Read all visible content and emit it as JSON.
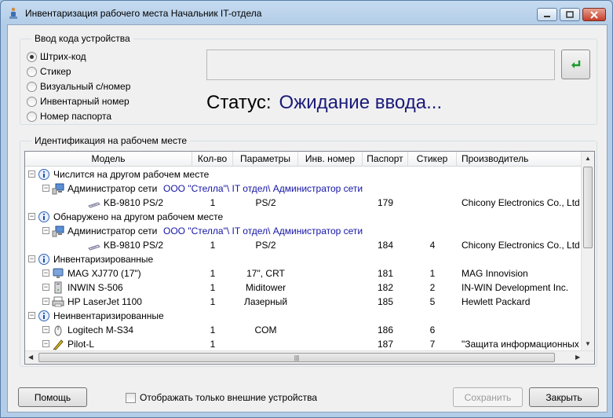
{
  "window": {
    "title": "Инвентаризация рабочего места Начальник IT-отдела"
  },
  "input_group": {
    "legend": "Ввод кода устройства",
    "options": [
      {
        "label": "Штрих-код",
        "selected": true
      },
      {
        "label": "Стикер",
        "selected": false
      },
      {
        "label": "Визуальный с/номер",
        "selected": false
      },
      {
        "label": "Инвентарный номер",
        "selected": false
      },
      {
        "label": "Номер паспорта",
        "selected": false
      }
    ],
    "code_value": "",
    "status_label": "Статус:",
    "status_value": "Ожидание ввода..."
  },
  "ident_group": {
    "legend": "Идентификация на рабочем месте",
    "columns": [
      "Модель",
      "Кол-во",
      "Параметры",
      "Инв. номер",
      "Паспорт",
      "Стикер",
      "Производитель"
    ],
    "rows": [
      {
        "level": 0,
        "icon": "info-icon",
        "model": "Числится на другом рабочем месте"
      },
      {
        "level": 1,
        "icon": "workstation-icon",
        "model": "Администратор сети",
        "path": "ООО \"Стелла\"\\ IT отдел\\ Администратор сети"
      },
      {
        "level": 2,
        "icon": "keyboard-icon",
        "model": "KB-9810 PS/2",
        "qty": "1",
        "params": "PS/2",
        "inv": "",
        "passport": "179",
        "sticker": "",
        "vendor": "Chicony Electronics Co., Ltd"
      },
      {
        "level": 0,
        "icon": "info-icon",
        "model": "Обнаружено на другом рабочем месте"
      },
      {
        "level": 1,
        "icon": "workstation-icon",
        "model": "Администратор сети",
        "path": "ООО \"Стелла\"\\ IT отдел\\ Администратор сети"
      },
      {
        "level": 2,
        "icon": "keyboard-icon",
        "model": "KB-9810 PS/2",
        "qty": "1",
        "params": "PS/2",
        "inv": "",
        "passport": "184",
        "sticker": "4",
        "vendor": "Chicony Electronics Co., Ltd"
      },
      {
        "level": 0,
        "icon": "info-icon",
        "model": "Инвентаризированные"
      },
      {
        "level": 1,
        "icon": "monitor-icon",
        "model": "MAG XJ770 (17\")",
        "qty": "1",
        "params": "17\", CRT",
        "inv": "",
        "passport": "181",
        "sticker": "1",
        "vendor": "MAG Innovision"
      },
      {
        "level": 1,
        "icon": "system-unit-icon",
        "model": "INWIN S-506",
        "qty": "1",
        "params": "Miditower",
        "inv": "",
        "passport": "182",
        "sticker": "2",
        "vendor": "IN-WIN Development Inc."
      },
      {
        "level": 1,
        "icon": "printer-icon",
        "model": "HP LaserJet 1100",
        "qty": "1",
        "params": "Лазерный",
        "inv": "",
        "passport": "185",
        "sticker": "5",
        "vendor": "Hewlett Packard"
      },
      {
        "level": 0,
        "icon": "info-icon",
        "model": "Неинвентаризированные"
      },
      {
        "level": 1,
        "icon": "mouse-icon",
        "model": "Logitech M-S34",
        "qty": "1",
        "params": "COM",
        "inv": "",
        "passport": "186",
        "sticker": "6",
        "vendor": ""
      },
      {
        "level": 1,
        "icon": "pda-icon",
        "model": "Pilot-L",
        "qty": "1",
        "params": "",
        "inv": "",
        "passport": "187",
        "sticker": "7",
        "vendor": "\"Защита информационных ..."
      }
    ]
  },
  "footer": {
    "help_label": "Помощь",
    "external_only_label": "Отображать только внешние устройства",
    "save_label": "Сохранить",
    "close_label": "Закрыть"
  }
}
